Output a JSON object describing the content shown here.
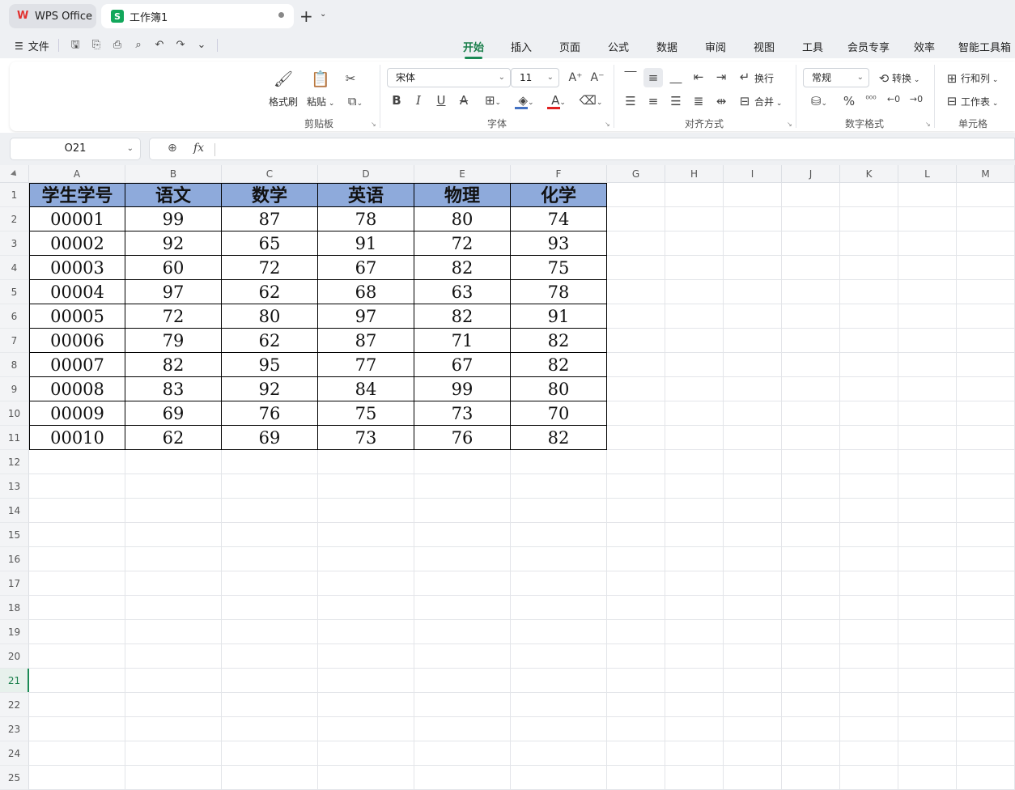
{
  "titlebar": {
    "app_tab": "WPS Office",
    "doc_tab": "工作簿1",
    "wps_logo": "W",
    "sheet_logo": "S"
  },
  "menu": {
    "file": "文件",
    "tabs": [
      "开始",
      "插入",
      "页面",
      "公式",
      "数据",
      "审阅",
      "视图",
      "工具",
      "会员专享",
      "效率",
      "智能工具箱"
    ],
    "active_tab": "开始"
  },
  "ribbon": {
    "clipboard": {
      "format_painter": "格式刷",
      "paste": "粘贴",
      "group": "剪贴板"
    },
    "font": {
      "name": "宋体",
      "size": "11",
      "group": "字体",
      "bold": "B",
      "italic": "I",
      "underline": "U",
      "strike": "A",
      "font_color": "A"
    },
    "alignment": {
      "wrap": "换行",
      "merge": "合并",
      "group": "对齐方式"
    },
    "number": {
      "format": "常规",
      "convert": "转换",
      "group": "数字格式",
      "percent": "%"
    },
    "cells": {
      "row_col": "行和列",
      "worksheet": "工作表",
      "group": "单元格"
    }
  },
  "formula_bar": {
    "name_box": "O21",
    "fx": "fx",
    "formula": ""
  },
  "sheet": {
    "columns": [
      "A",
      "B",
      "C",
      "D",
      "E",
      "F",
      "G",
      "H",
      "I",
      "J",
      "K",
      "L",
      "M"
    ],
    "rows": [
      "1",
      "2",
      "3",
      "4",
      "5",
      "6",
      "7",
      "8",
      "9",
      "10",
      "11",
      "12",
      "13",
      "14",
      "15",
      "16",
      "17",
      "18",
      "19",
      "20",
      "21",
      "22",
      "23",
      "24",
      "25"
    ],
    "selected_row": "21",
    "header_fill": "#8eaadb",
    "table": {
      "headers": [
        "学生学号",
        "语文",
        "数学",
        "英语",
        "物理",
        "化学"
      ],
      "rows": [
        [
          "00001",
          "99",
          "87",
          "78",
          "80",
          "74"
        ],
        [
          "00002",
          "92",
          "65",
          "91",
          "72",
          "93"
        ],
        [
          "00003",
          "60",
          "72",
          "67",
          "82",
          "75"
        ],
        [
          "00004",
          "97",
          "62",
          "68",
          "63",
          "78"
        ],
        [
          "00005",
          "72",
          "80",
          "97",
          "82",
          "91"
        ],
        [
          "00006",
          "79",
          "62",
          "87",
          "71",
          "82"
        ],
        [
          "00007",
          "82",
          "95",
          "77",
          "67",
          "82"
        ],
        [
          "00008",
          "83",
          "92",
          "84",
          "99",
          "80"
        ],
        [
          "00009",
          "69",
          "76",
          "75",
          "73",
          "70"
        ],
        [
          "00010",
          "62",
          "69",
          "73",
          "76",
          "82"
        ]
      ]
    }
  }
}
